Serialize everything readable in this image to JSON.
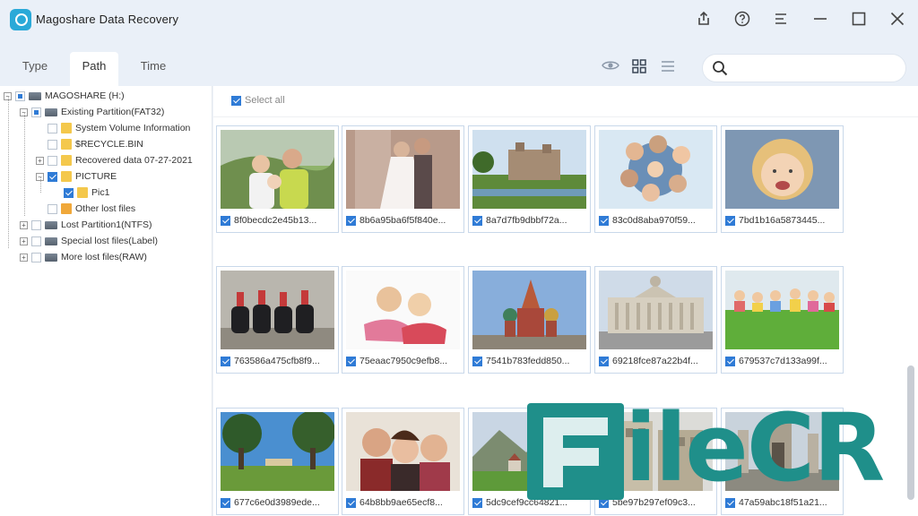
{
  "app": {
    "title": "Magoshare Data Recovery"
  },
  "titlebar_icons": [
    "share-icon",
    "help-icon",
    "menu-icon",
    "minimize-icon",
    "maximize-icon",
    "close-icon"
  ],
  "tabs": [
    {
      "label": "Type",
      "active": false
    },
    {
      "label": "Path",
      "active": true
    },
    {
      "label": "Time",
      "active": false
    }
  ],
  "view_icons": [
    "preview-eye-icon",
    "grid-view-icon",
    "list-view-icon"
  ],
  "search": {
    "placeholder": "",
    "value": ""
  },
  "tree": [
    {
      "label": "MAGOSHARE (H:)",
      "level": 0,
      "expander": "−",
      "check": "partial",
      "icon": "drive"
    },
    {
      "label": "Existing Partition(FAT32)",
      "level": 1,
      "expander": "−",
      "check": "partial",
      "icon": "drive"
    },
    {
      "label": "System Volume Information",
      "level": 2,
      "expander": "",
      "check": "none",
      "icon": "folder"
    },
    {
      "label": "$RECYCLE.BIN",
      "level": 2,
      "expander": "",
      "check": "none",
      "icon": "folder"
    },
    {
      "label": "Recovered data 07-27-2021",
      "level": 2,
      "expander": "+",
      "check": "none",
      "icon": "folder"
    },
    {
      "label": "PICTURE",
      "level": 2,
      "expander": "−",
      "check": "checked",
      "icon": "folder"
    },
    {
      "label": "Pic1",
      "level": 3,
      "expander": "",
      "check": "checked",
      "icon": "folder"
    },
    {
      "label": "Other lost files",
      "level": 2,
      "expander": "",
      "check": "none",
      "icon": "lost"
    },
    {
      "label": "Lost Partition1(NTFS)",
      "level": 1,
      "expander": "+",
      "check": "none",
      "icon": "drive"
    },
    {
      "label": "Special lost files(Label)",
      "level": 1,
      "expander": "+",
      "check": "none",
      "icon": "drive"
    },
    {
      "label": "More lost files(RAW)",
      "level": 1,
      "expander": "+",
      "check": "none",
      "icon": "drive"
    }
  ],
  "main": {
    "select_all_label": "Select all"
  },
  "files": [
    {
      "name": "8f0becdc2e45b13...",
      "thumb": "family-outdoor"
    },
    {
      "name": "8b6a95ba6f5f840e...",
      "thumb": "wedding-couple"
    },
    {
      "name": "8a7d7fb9dbbf72a...",
      "thumb": "castle-landscape"
    },
    {
      "name": "83c0d8aba970f59...",
      "thumb": "friends-circle"
    },
    {
      "name": "7bd1b16a5873445...",
      "thumb": "laughing-child"
    },
    {
      "name": "763586a475cfb8f9...",
      "thumb": "horse-guards"
    },
    {
      "name": "75eaac7950c9efb8...",
      "thumb": "two-kids"
    },
    {
      "name": "7541b783fedd850...",
      "thumb": "moscow-cathedral"
    },
    {
      "name": "69218fce87a22b4f...",
      "thumb": "national-gallery"
    },
    {
      "name": "679537c7d133a99f...",
      "thumb": "kids-on-grass"
    },
    {
      "name": "677c6e0d3989ede...",
      "thumb": "park-trees"
    },
    {
      "name": "64b8bb9ae65ecf8...",
      "thumb": "family-portrait"
    },
    {
      "name": "5dc9cef9cc64821...",
      "thumb": "mountain-village"
    },
    {
      "name": "5be97b297ef09c3...",
      "thumb": "street-building"
    },
    {
      "name": "47a59abc18f51a21...",
      "thumb": "ruins"
    }
  ],
  "watermark": {
    "text": "ileCR"
  },
  "colors": {
    "accent": "#2f7bd6",
    "watermark": "#1f8f8a"
  }
}
